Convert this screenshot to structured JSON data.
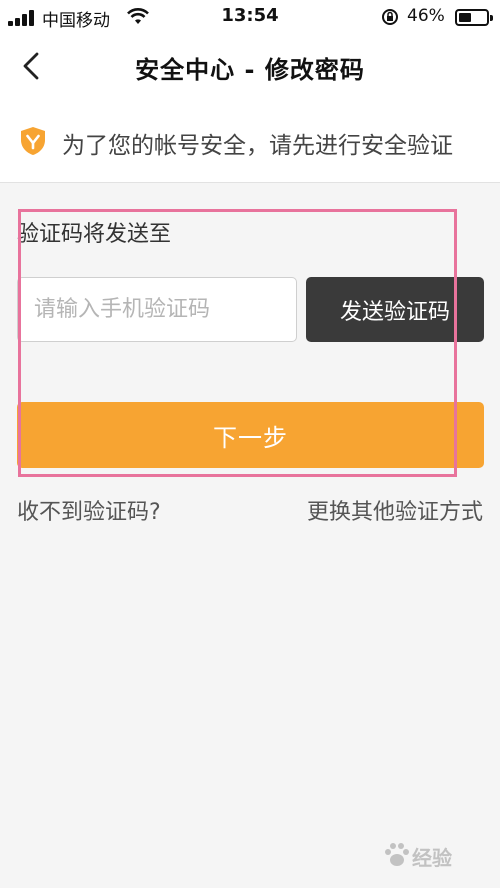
{
  "status_bar": {
    "carrier": "中国移动",
    "time": "13:54",
    "battery_percent": "46%",
    "battery_level": 0.46,
    "signal_bars": 4
  },
  "nav": {
    "title": "安全中心 - 修改密码",
    "back_icon": "chevron-left-icon"
  },
  "notice": {
    "icon": "shield-icon",
    "icon_color": "#f7a432",
    "text": "为了您的帐号安全，请先进行安全验证"
  },
  "verification": {
    "sent_label": "验证码将发送至",
    "code_placeholder": "请输入手机验证码",
    "send_button_label": "发送验证码",
    "next_button_label": "下一步"
  },
  "links": {
    "no_code": "收不到验证码?",
    "other_method": "更换其他验证方式"
  },
  "colors": {
    "accent": "#f7a432",
    "send_button_bg": "#3a3a3a",
    "highlight_border": "#e8739c",
    "page_bg": "#f5f5f5"
  },
  "watermark": {
    "text": "经验"
  }
}
